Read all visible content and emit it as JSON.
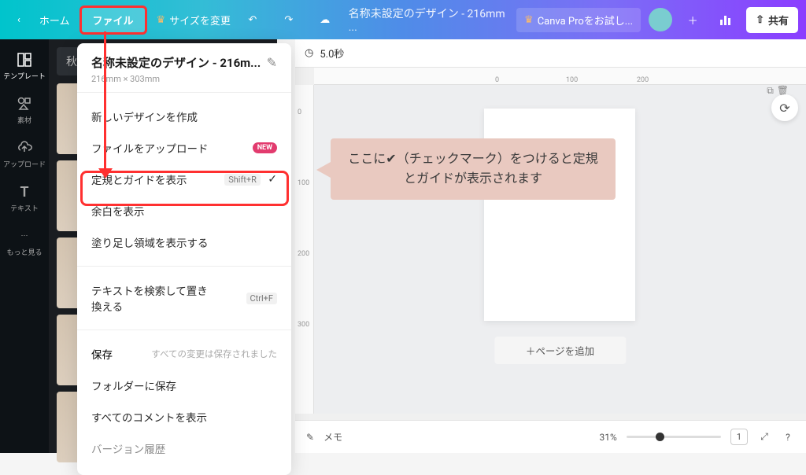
{
  "header": {
    "home": "ホーム",
    "file": "ファイル",
    "resize": "サイズを変更",
    "doc_title": "名称未設定のデザイン - 216mm ...",
    "pro": "Canva Proをお試し...",
    "share": "共有"
  },
  "sidebar": {
    "items": [
      {
        "label": "テンプレート"
      },
      {
        "label": "素材"
      },
      {
        "label": "アップロード"
      },
      {
        "label": "テキスト"
      },
      {
        "label": "もっと見る"
      }
    ]
  },
  "side_panel": {
    "search_value": "秋"
  },
  "file_menu": {
    "title": "名称未設定のデザイン - 216m...",
    "dimensions": "216mm × 303mm",
    "new_design": "新しいデザインを作成",
    "upload": "ファイルをアップロード",
    "upload_badge": "NEW",
    "rulers": "定規とガイドを表示",
    "rulers_shortcut": "Shift+R",
    "margins": "余白を表示",
    "bleed": "塗り足し領域を表示する",
    "find_replace": "テキストを検索して置き換える",
    "find_shortcut": "Ctrl+F",
    "save": "保存",
    "save_status": "すべての変更は保存されました",
    "save_to_folder": "フォルダーに保存",
    "show_comments": "すべてのコメントを表示",
    "version_history": "バージョン履歴"
  },
  "canvas": {
    "duration": "5.0秒",
    "add_page": "＋ページを追加",
    "ruler_h": [
      "0",
      "100",
      "200"
    ],
    "ruler_v": [
      "0",
      "100",
      "200",
      "300"
    ]
  },
  "annotation": {
    "text": "ここに✔（チェックマーク）をつけると定規とガイドが表示されます"
  },
  "bottom": {
    "notes": "メモ",
    "zoom": "31%",
    "page_indicator": "1"
  }
}
